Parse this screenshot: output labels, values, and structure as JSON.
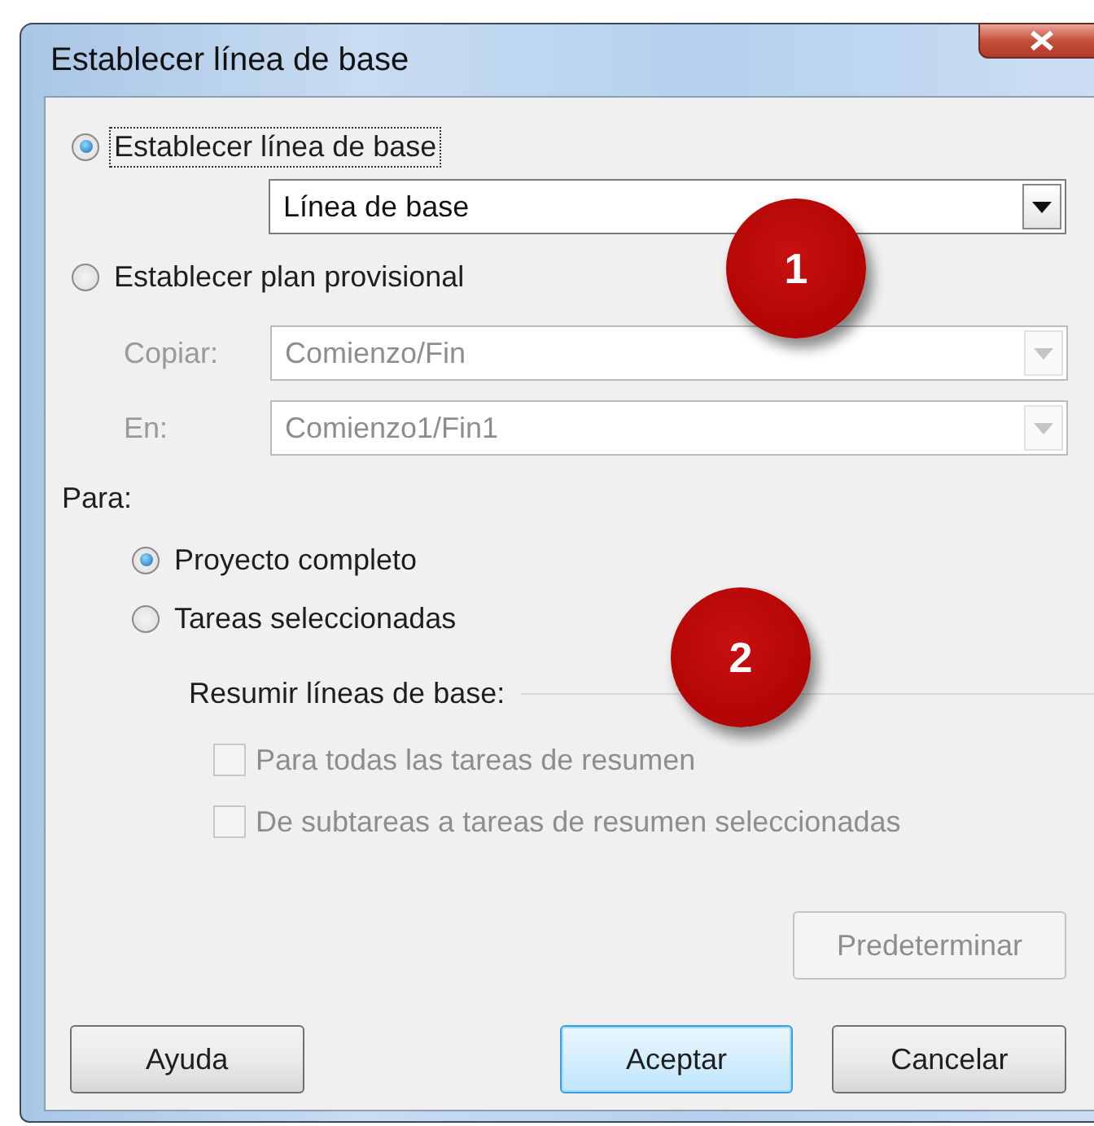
{
  "window": {
    "title": "Establecer línea de base"
  },
  "mode_options": [
    {
      "label": "Establecer línea de base",
      "selected": true,
      "focused": true
    },
    {
      "label": "Establecer plan provisional",
      "selected": false,
      "focused": false
    }
  ],
  "baseline_select": {
    "value": "Línea de base",
    "disabled": false
  },
  "interim_fields": [
    {
      "label": "Copiar:",
      "value": "Comienzo/Fin",
      "disabled": true
    },
    {
      "label": "En:",
      "value": "Comienzo1/Fin1",
      "disabled": true
    }
  ],
  "scope": {
    "label": "Para:",
    "options": [
      {
        "label": "Proyecto completo",
        "selected": true
      },
      {
        "label": "Tareas seleccionadas",
        "selected": false
      }
    ]
  },
  "rollup": {
    "label": "Resumir líneas de base:",
    "checkboxes": [
      {
        "label": "Para todas las tareas de resumen",
        "checked": false,
        "disabled": true
      },
      {
        "label": "De subtareas a tareas de resumen seleccionadas",
        "checked": false,
        "disabled": true
      }
    ]
  },
  "default_button": {
    "label": "Predeterminar",
    "disabled": true
  },
  "buttons": [
    {
      "label": "Ayuda",
      "default": false
    },
    {
      "label": "Aceptar",
      "default": true
    },
    {
      "label": "Cancelar",
      "default": false
    }
  ],
  "callouts": [
    {
      "label": "1"
    },
    {
      "label": "2"
    }
  ]
}
